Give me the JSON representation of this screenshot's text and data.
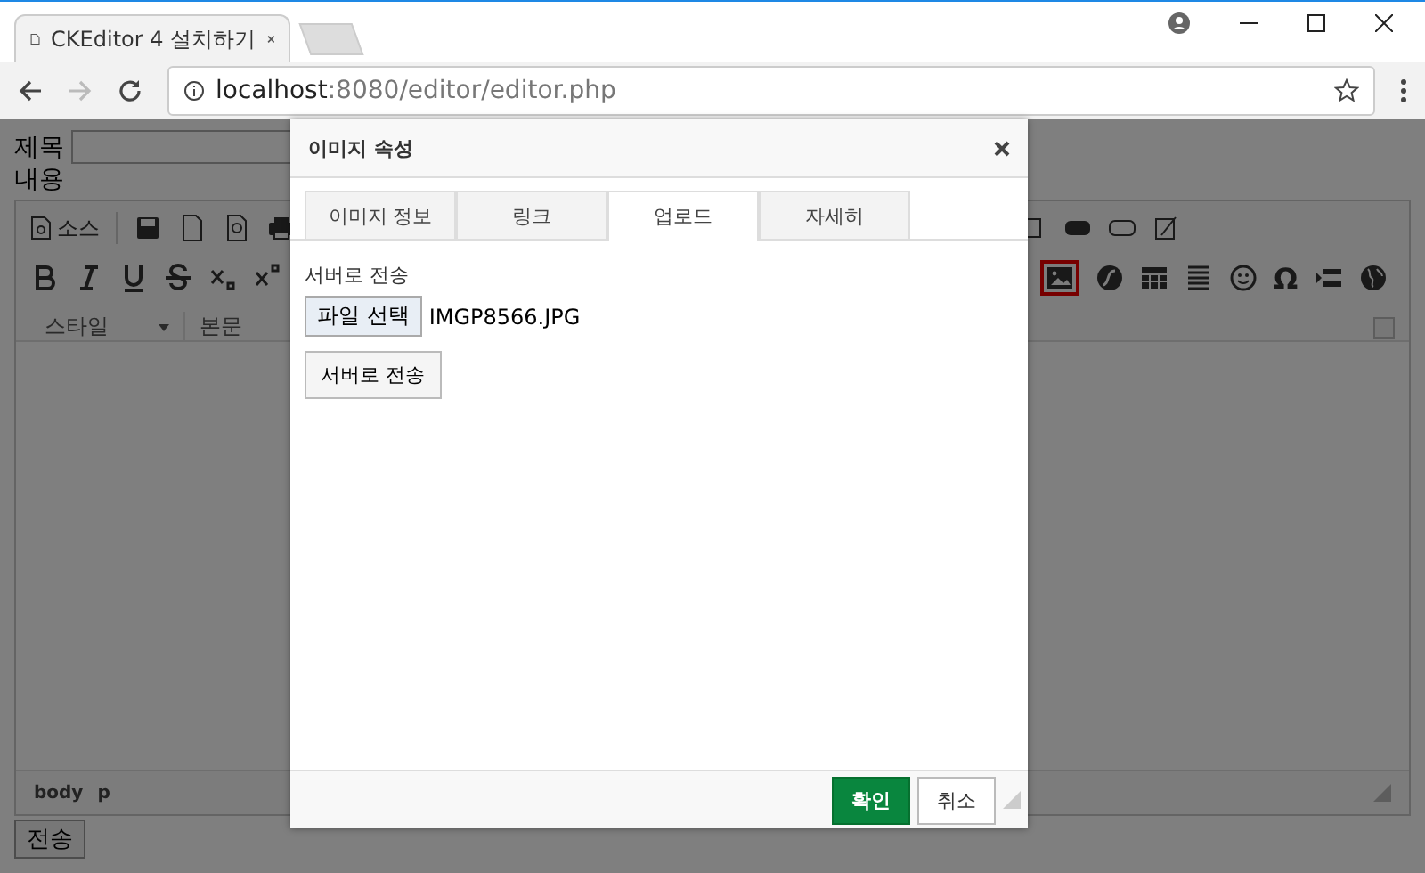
{
  "browser": {
    "tab_title": "CKEditor 4 설치하기",
    "url_host": "localhost",
    "url_rest": ":8080/editor/editor.php"
  },
  "form": {
    "title_label": "제목",
    "content_label": "내용",
    "submit_button": "전송"
  },
  "editor": {
    "source_button": "소스",
    "combos": [
      {
        "label": "스타일"
      },
      {
        "label": "본문"
      }
    ],
    "image_button": {
      "highlighted": true
    },
    "special_char_button": "Ω",
    "path": [
      "body",
      "p"
    ]
  },
  "dialog": {
    "title": "이미지 속성",
    "tabs": [
      {
        "label": "이미지 정보",
        "selected": false
      },
      {
        "label": "링크",
        "selected": false
      },
      {
        "label": "업로드",
        "selected": true
      },
      {
        "label": "자세히",
        "selected": false
      }
    ],
    "upload": {
      "label": "서버로 전송",
      "file_button": "파일 선택",
      "file_name": "IMGP8566.JPG",
      "send_button": "서버로 전송"
    },
    "ok_button": "확인",
    "cancel_button": "취소"
  }
}
